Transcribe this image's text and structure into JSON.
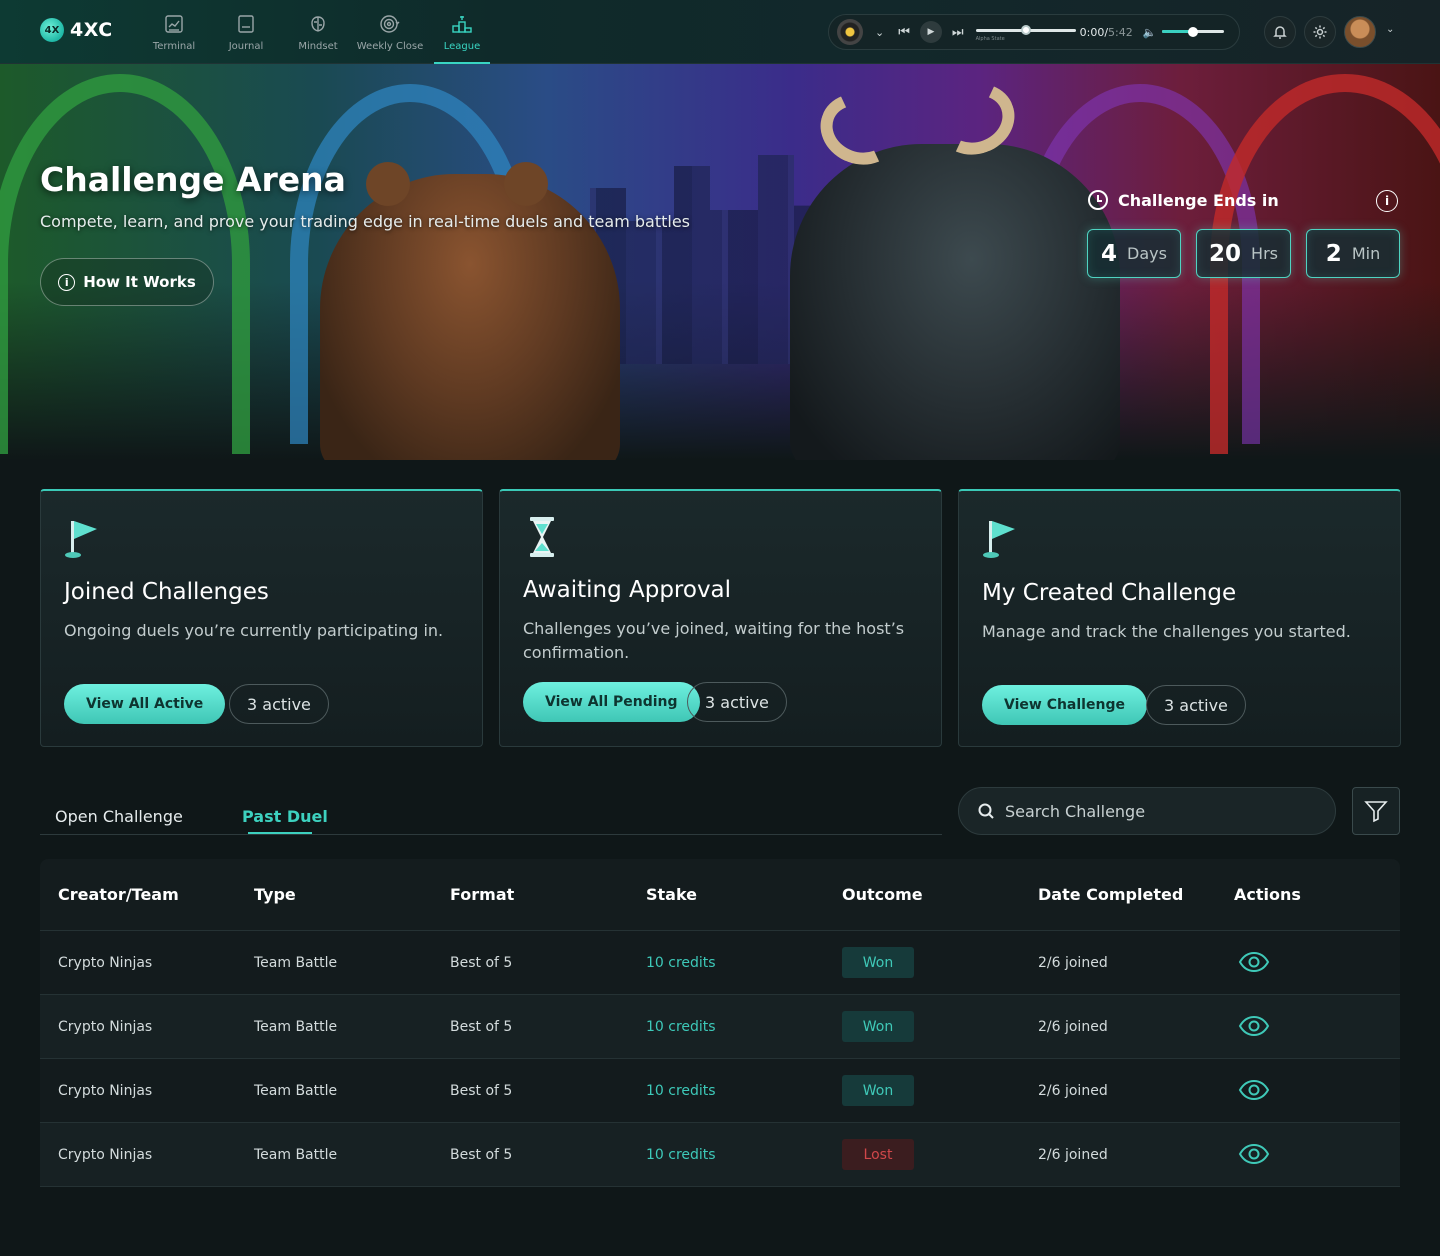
{
  "brand": {
    "name": "4XC",
    "mark": "4X"
  },
  "nav": {
    "items": [
      {
        "label": "Terminal",
        "icon": "terminal-icon"
      },
      {
        "label": "Journal",
        "icon": "journal-icon"
      },
      {
        "label": "Mindset",
        "icon": "brain-icon"
      },
      {
        "label": "Weekly Close",
        "icon": "target-icon"
      },
      {
        "label": "League",
        "icon": "podium-icon",
        "active": true
      }
    ]
  },
  "player": {
    "track_name": "Alpha State",
    "elapsed": "0:00",
    "duration": "5:42",
    "progress": 0.5,
    "volume": 0.5
  },
  "hero": {
    "title": "Challenge Arena",
    "subtitle": "Compete, learn, and prove your trading edge in real-time duels and team battles",
    "how_button": "How It Works",
    "ends_label": "Challenge Ends in",
    "countdown": [
      {
        "value": "4",
        "unit": "Days"
      },
      {
        "value": "20",
        "unit": "Hrs"
      },
      {
        "value": "2",
        "unit": "Min"
      }
    ]
  },
  "cards": [
    {
      "title": "Joined Challenges",
      "desc": "Ongoing duels you’re currently participating in.",
      "button": "View All Active",
      "count": "3 active",
      "icon": "flag-icon"
    },
    {
      "title": "Awaiting Approval",
      "desc": "Challenges you’ve joined, waiting for the host’s confirmation.",
      "button": "View All Pending",
      "count": "3 active",
      "icon": "hourglass-icon"
    },
    {
      "title": "My Created Challenge",
      "desc": "Manage and track the challenges you started.",
      "button": "View Challenge",
      "count": "3 active",
      "icon": "flag-icon"
    }
  ],
  "tabs": [
    {
      "label": "Open Challenge"
    },
    {
      "label": "Past Duel",
      "active": true
    }
  ],
  "search": {
    "placeholder": "Search Challenge"
  },
  "table": {
    "headers": [
      "Creator/Team",
      "Type",
      "Format",
      "Stake",
      "Outcome",
      "Date Completed",
      "Actions"
    ],
    "rows": [
      {
        "creator": "Crypto Ninjas",
        "type": "Team Battle",
        "format": "Best of 5",
        "stake": "10 credits",
        "outcome": "Won",
        "date": "2/6 joined"
      },
      {
        "creator": "Crypto Ninjas",
        "type": "Team Battle",
        "format": "Best of 5",
        "stake": "10 credits",
        "outcome": "Won",
        "date": "2/6 joined"
      },
      {
        "creator": "Crypto Ninjas",
        "type": "Team Battle",
        "format": "Best of 5",
        "stake": "10 credits",
        "outcome": "Won",
        "date": "2/6 joined"
      },
      {
        "creator": "Crypto Ninjas",
        "type": "Team Battle",
        "format": "Best of 5",
        "stake": "10 credits",
        "outcome": "Lost",
        "date": "2/6 joined"
      }
    ]
  },
  "colors": {
    "accent": "#3dd1bf",
    "won": "#3fc9b8",
    "lost": "#d0474a",
    "background": "#0f1718"
  }
}
